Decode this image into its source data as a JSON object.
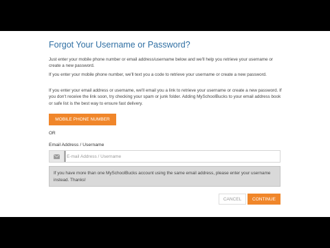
{
  "page": {
    "title": "Forgot Your Username or Password?",
    "paragraphs": [
      "Just enter your mobile phone number or email address/username below and we'll help you retrieve your username or create a new password.",
      "If you enter your mobile phone number, we'll text you a code to retrieve your username or create a new password.",
      "If you enter your email address or username, we'll email you a link to retrieve your username or create a new password. If you don't receive the link soon, try checking your spam or junk folder. Adding MySchoolBucks to your email address book or safe list is the best way to ensure fast delivery."
    ]
  },
  "form": {
    "mobile_button_label": "MOBILE PHONE NUMBER",
    "or_text": "OR",
    "email_label": "Email Address / Username",
    "email_placeholder": "E-mail Address / Username",
    "email_value": "",
    "addon_icon": "envelope-icon",
    "notice": "If you have more than one MySchoolBucks account using the same email address, please enter your username instead. Thanks!",
    "cancel_label": "CANCEL",
    "continue_label": "CONTINUE"
  },
  "colors": {
    "title": "#2f6fa3",
    "accent": "#f0862a",
    "notice_bg": "#d9d9d9"
  }
}
